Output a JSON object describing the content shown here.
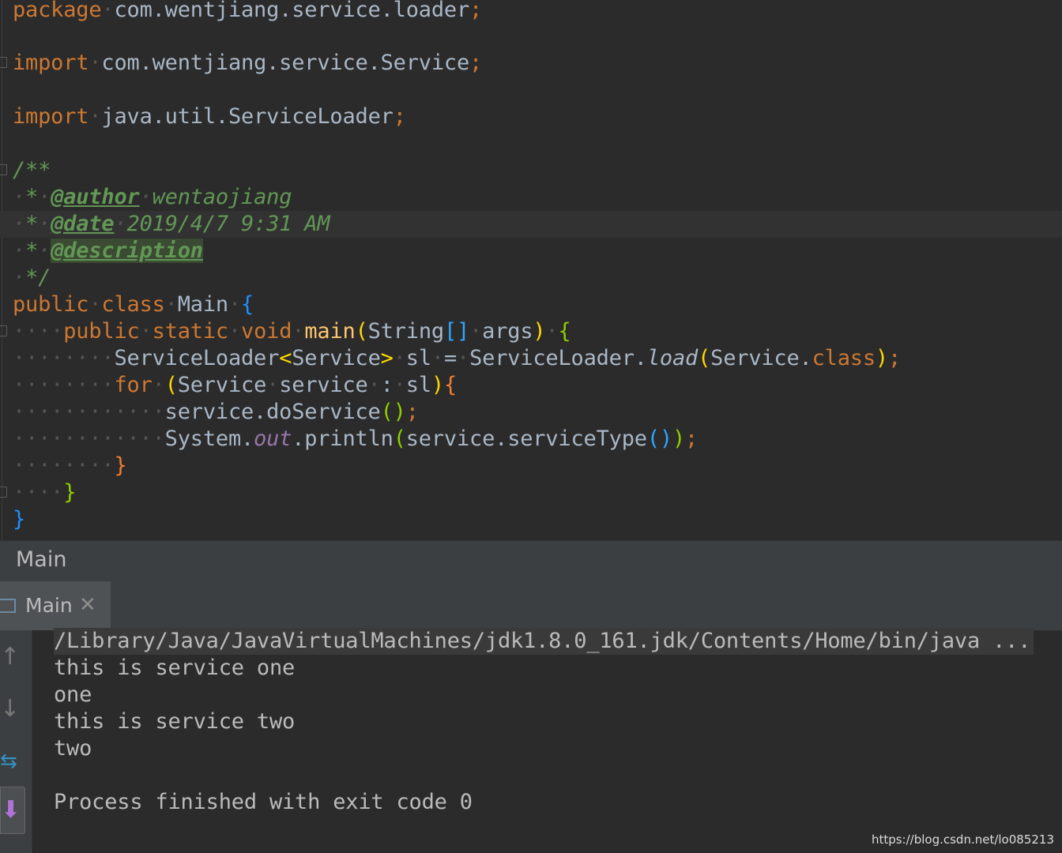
{
  "editor": {
    "package_kw": "package",
    "package_name": "com.wentjiang.service.loader",
    "import_kw": "import",
    "import1": "com.wentjiang.service.Service",
    "import2": "java.util.ServiceLoader",
    "javadoc_open": "/**",
    "author_tag": "@author",
    "author_value": "wentaojiang",
    "date_tag": "@date",
    "date_value": "2019/4/7 9:31 AM",
    "description_tag": "@description",
    "javadoc_close": "*/",
    "public_kw": "public",
    "class_kw": "class",
    "class_name": "Main",
    "static_kw": "static",
    "void_kw": "void",
    "method_name": "main",
    "param_type": "String",
    "param_name": "args",
    "loader_type": "ServiceLoader",
    "generic_type": "Service",
    "var_sl": "sl",
    "loader_class": "ServiceLoader.",
    "load_method": "load",
    "service_ref": "Service.",
    "class_literal": "class",
    "for_kw": "for",
    "loop_type": "Service",
    "loop_var": "service",
    "call1": "service.doService",
    "system": "System.",
    "out_field": "out",
    "println": ".println",
    "call2": "service.serviceType"
  },
  "run_panel": {
    "title": "Main",
    "tab_label": "Main",
    "tab_close": "✕"
  },
  "console": {
    "lines": [
      "/Library/Java/JavaVirtualMachines/jdk1.8.0_161.jdk/Contents/Home/bin/java ...",
      "this is service one",
      "one",
      "this is service two",
      "two",
      "",
      "Process finished with exit code 0"
    ]
  },
  "icons": {
    "rerun": "↑",
    "stop": "↓",
    "soft_wrap": "⇆",
    "scroll_end": "⬇"
  },
  "watermark": "https://blog.csdn.net/lo085213"
}
